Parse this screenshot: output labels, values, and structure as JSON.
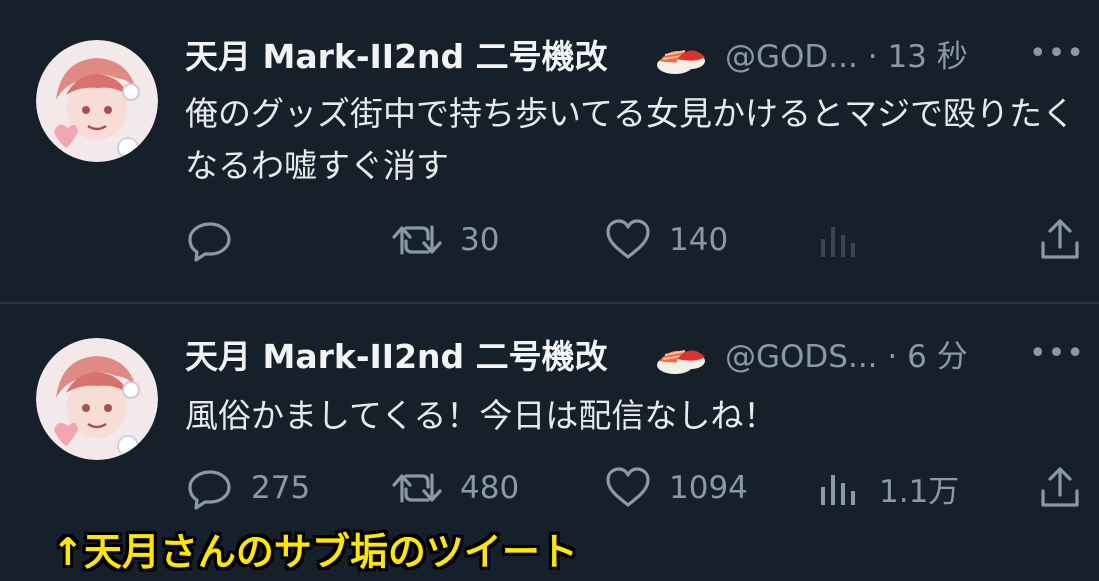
{
  "tweets": [
    {
      "author": {
        "display_name": "天月 Mark-II2nd 二号機改",
        "name_emoji": "sushi-emoji",
        "handle": "@GOD...",
        "separator": "·",
        "time": "13 秒"
      },
      "text": "俺のグッズ街中で持ち歩いてる女見かけるとマジで殴りたくなるわ嘘すぐ消す",
      "actions": {
        "reply_count": "",
        "retweet_count": "30",
        "like_count": "140",
        "views_count": ""
      }
    },
    {
      "author": {
        "display_name": "天月 Mark-II2nd 二号機改",
        "name_emoji": "sushi-emoji",
        "handle": "@GODS...",
        "separator": "·",
        "time": "6 分"
      },
      "text": "風俗かましてくる！今日は配信なしね！",
      "actions": {
        "reply_count": "275",
        "retweet_count": "480",
        "like_count": "1094",
        "views_count": "1.1万"
      }
    }
  ],
  "more_glyph": "•••",
  "caption": "↑天月さんのサブ垢のツイート",
  "colors": {
    "background": "#15202b",
    "text": "#e7e9ea",
    "secondary": "#8b98a5",
    "caption": "#ffe600"
  }
}
